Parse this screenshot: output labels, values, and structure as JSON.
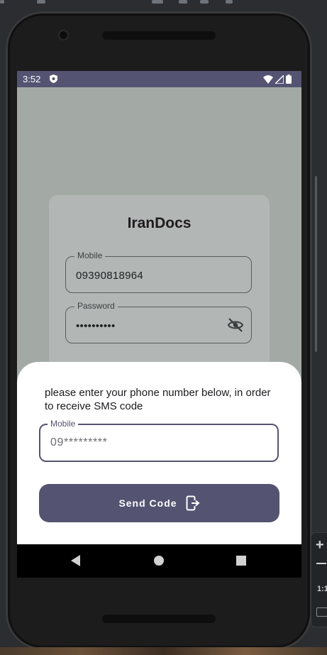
{
  "status_bar": {
    "time": "3:52"
  },
  "login_card": {
    "title": "IranDocs",
    "mobile": {
      "label": "Mobile",
      "value": "09390818964"
    },
    "password": {
      "label": "Password",
      "value": "••••••••••"
    }
  },
  "bottom_sheet": {
    "message": "please enter your phone number below, in order to receive SMS code",
    "mobile_field": {
      "label": "Mobile",
      "placeholder": "09*********"
    },
    "send_button": "Send Code"
  },
  "emulator_toolbar": {
    "zoom_in": "+",
    "ratio": "1:1"
  },
  "colors": {
    "primary": "#545372",
    "scrim": "#a3aaa5",
    "card": "#b2b6b4",
    "sheet": "#ffffff"
  }
}
